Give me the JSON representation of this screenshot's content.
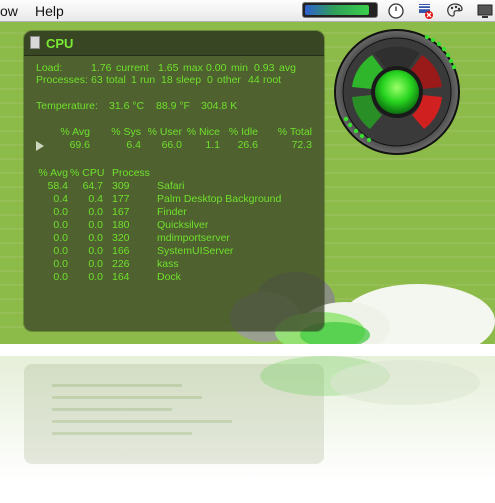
{
  "menubar": {
    "items": [
      "ow",
      "Help"
    ],
    "meter_level": 0.92,
    "icons": [
      "activity-meter-icon",
      "clock-icon",
      "flag-icon",
      "palette-icon",
      "display-icon"
    ]
  },
  "panel": {
    "title": "CPU",
    "load_label": "Load:",
    "load_current": "1.76",
    "load_current_label": "current",
    "load_max": "1.65",
    "load_max_label": "max",
    "load_min": "0.00",
    "load_min_label": "min",
    "load_avg": "0.93",
    "load_avg_label": "avg",
    "processes_label": "Processes:",
    "proc_total": "63",
    "proc_total_label": "total",
    "proc_run": "1",
    "proc_run_label": "run",
    "proc_sleep": "18",
    "proc_sleep_label": "sleep",
    "proc_other": "0",
    "proc_other_label": "other",
    "proc_root": "44",
    "proc_root_label": "root",
    "temp_label": "Temperature:",
    "temp_c": "31.6 °C",
    "temp_f": "88.9 °F",
    "temp_k": "304.8 K",
    "stats_headers": [
      "% Avg",
      "% Sys",
      "% User",
      "% Nice",
      "% Idle",
      "% Total"
    ],
    "stats_values": [
      "69.6",
      "6.4",
      "66.0",
      "1.1",
      "26.6",
      "72.3"
    ],
    "proc_headers": [
      "% Avg",
      "% CPU",
      "Process"
    ],
    "processes": [
      {
        "avg": "58.4",
        "cpu": "64.7",
        "pid": "309",
        "name": "Safari"
      },
      {
        "avg": "0.4",
        "cpu": "0.4",
        "pid": "177",
        "name": "Palm Desktop Background"
      },
      {
        "avg": "0.0",
        "cpu": "0.0",
        "pid": "167",
        "name": "Finder"
      },
      {
        "avg": "0.0",
        "cpu": "0.0",
        "pid": "180",
        "name": "Quicksilver"
      },
      {
        "avg": "0.0",
        "cpu": "0.0",
        "pid": "320",
        "name": "mdimportserver"
      },
      {
        "avg": "0.0",
        "cpu": "0.0",
        "pid": "166",
        "name": "SystemUIServer"
      },
      {
        "avg": "0.0",
        "cpu": "0.0",
        "pid": "226",
        "name": "kass"
      },
      {
        "avg": "0.0",
        "cpu": "0.0",
        "pid": "164",
        "name": "Dock"
      }
    ]
  },
  "colors": {
    "desktop": "#8dbb4a",
    "panel_text": "#6fe02c",
    "dial_green": "#2ee02a",
    "dial_red": "#d02020"
  }
}
